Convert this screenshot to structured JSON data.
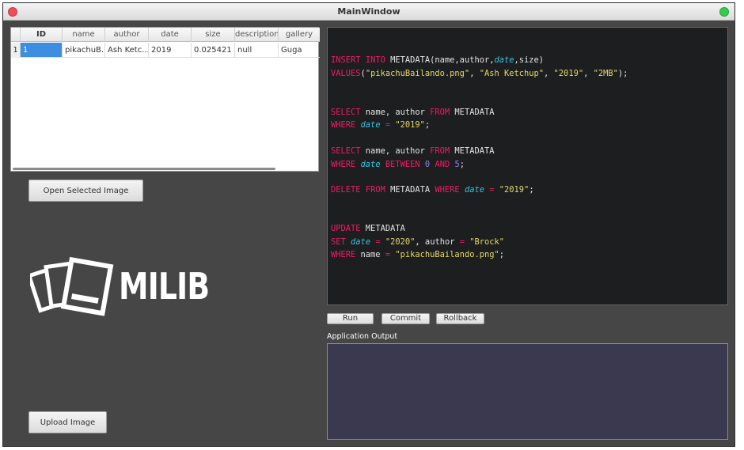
{
  "window": {
    "title": "MainWindow"
  },
  "table": {
    "columns": [
      "ID",
      "name",
      "author",
      "date",
      "size",
      "description",
      "gallery"
    ],
    "rows": [
      {
        "rownum": "1",
        "id": "1",
        "name": "pikachuB...",
        "author": "Ash Ketc...",
        "date": "2019",
        "size": "0.025421",
        "description": "null",
        "gallery": "Guga"
      }
    ]
  },
  "buttons": {
    "open_selected": "Open Selected Image",
    "upload": "Upload Image",
    "run": "Run",
    "commit": "Commit",
    "rollback": "Rollback"
  },
  "logo": {
    "text": "MILIB"
  },
  "output": {
    "label": "Application Output"
  },
  "colors": {
    "keyword": "#ee1c64",
    "function": "#39c2e3",
    "string": "#e5d96a",
    "number": "#9b7cf4",
    "editor_bg": "#1d1e1f",
    "output_bg": "#3b3950",
    "selection": "#3d8ee0"
  },
  "editor": {
    "lines": [
      [],
      [
        [
          "k",
          "INSERT"
        ],
        [
          "t",
          " "
        ],
        [
          "k",
          "INTO"
        ],
        [
          "t",
          " METADATA(name,author,"
        ],
        [
          "f",
          "date"
        ],
        [
          "t",
          ",size)"
        ]
      ],
      [
        [
          "k",
          "VALUES"
        ],
        [
          "t",
          "("
        ],
        [
          "s",
          "\"pikachuBailando.png\""
        ],
        [
          "t",
          ", "
        ],
        [
          "s",
          "\"Ash Ketchup\""
        ],
        [
          "t",
          ", "
        ],
        [
          "s",
          "\"2019\""
        ],
        [
          "t",
          ", "
        ],
        [
          "s",
          "\"2MB\""
        ],
        [
          "t",
          ");"
        ]
      ],
      [],
      [],
      [
        [
          "k",
          "SELECT"
        ],
        [
          "t",
          " name, author "
        ],
        [
          "k",
          "FROM"
        ],
        [
          "t",
          " METADATA"
        ]
      ],
      [
        [
          "k",
          "WHERE"
        ],
        [
          "t",
          " "
        ],
        [
          "f",
          "date"
        ],
        [
          "t",
          " "
        ],
        [
          "k",
          "="
        ],
        [
          "t",
          " "
        ],
        [
          "s",
          "\"2019\""
        ],
        [
          "t",
          ";"
        ]
      ],
      [],
      [
        [
          "k",
          "SELECT"
        ],
        [
          "t",
          " name, author "
        ],
        [
          "k",
          "FROM"
        ],
        [
          "t",
          " METADATA"
        ]
      ],
      [
        [
          "k",
          "WHERE"
        ],
        [
          "t",
          " "
        ],
        [
          "f",
          "date"
        ],
        [
          "t",
          " "
        ],
        [
          "k",
          "BETWEEN"
        ],
        [
          "t",
          " "
        ],
        [
          "n",
          "0"
        ],
        [
          "t",
          " "
        ],
        [
          "k",
          "AND"
        ],
        [
          "t",
          " "
        ],
        [
          "n",
          "5"
        ],
        [
          "t",
          ";"
        ]
      ],
      [],
      [
        [
          "k",
          "DELETE"
        ],
        [
          "t",
          " "
        ],
        [
          "k",
          "FROM"
        ],
        [
          "t",
          " METADATA "
        ],
        [
          "k",
          "WHERE"
        ],
        [
          "t",
          " "
        ],
        [
          "f",
          "date"
        ],
        [
          "t",
          " "
        ],
        [
          "k",
          "="
        ],
        [
          "t",
          " "
        ],
        [
          "s",
          "\"2019\""
        ],
        [
          "t",
          ";"
        ]
      ],
      [],
      [],
      [
        [
          "k",
          "UPDATE"
        ],
        [
          "t",
          " METADATA"
        ]
      ],
      [
        [
          "k",
          "SET"
        ],
        [
          "t",
          " "
        ],
        [
          "f",
          "date"
        ],
        [
          "t",
          " "
        ],
        [
          "k",
          "="
        ],
        [
          "t",
          " "
        ],
        [
          "s",
          "\"2020\""
        ],
        [
          "t",
          ", author "
        ],
        [
          "k",
          "="
        ],
        [
          "t",
          " "
        ],
        [
          "s",
          "\"Brock\""
        ]
      ],
      [
        [
          "k",
          "WHERE"
        ],
        [
          "t",
          " name "
        ],
        [
          "k",
          "="
        ],
        [
          "t",
          " "
        ],
        [
          "s",
          "\"pikachuBailando.png\""
        ],
        [
          "t",
          ";"
        ]
      ]
    ]
  }
}
